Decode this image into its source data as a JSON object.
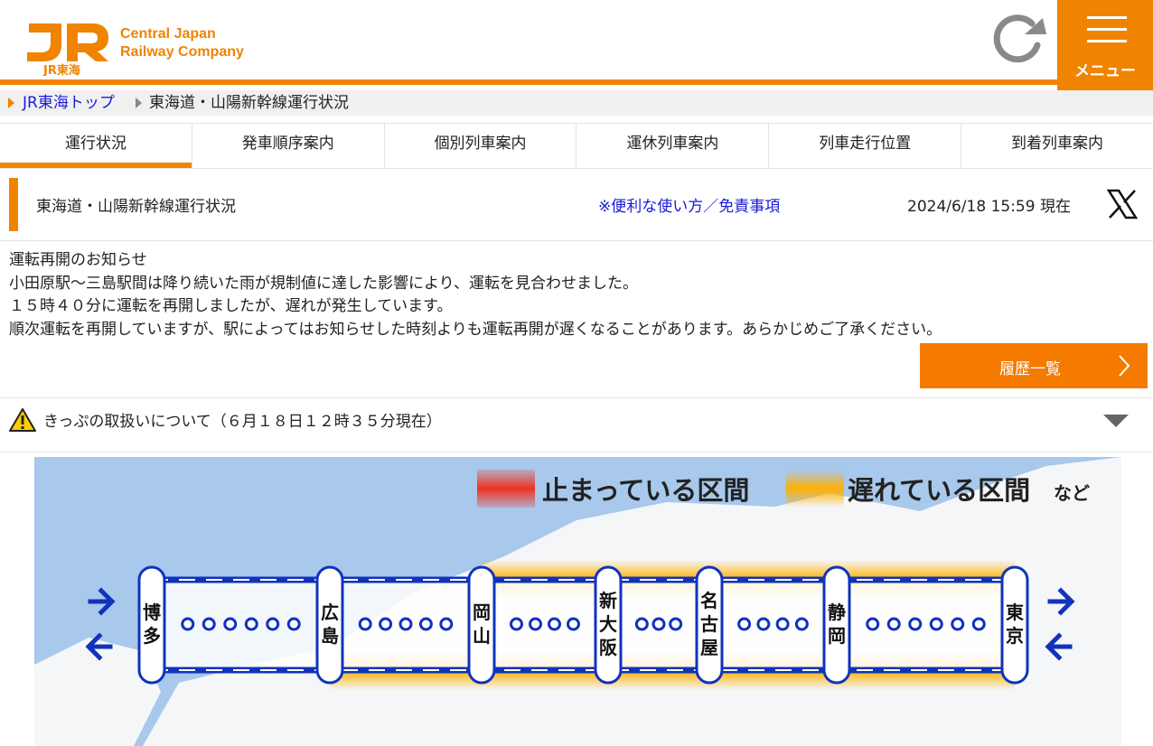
{
  "header": {
    "logo_text": "JR",
    "logo_sub": "JR東海",
    "corp_line1": "Central Japan",
    "corp_line2": "Railway Company",
    "menu_label": "メニュー"
  },
  "breadcrumb": {
    "top_link": "JR東海トップ",
    "current": "東海道・山陽新幹線運行状況"
  },
  "tabs": [
    {
      "label": "運行状況"
    },
    {
      "label": "発車順序案内"
    },
    {
      "label": "個別列車案内"
    },
    {
      "label": "運休列車案内"
    },
    {
      "label": "列車走行位置"
    },
    {
      "label": "到着列車案内"
    }
  ],
  "status": {
    "title": "東海道・山陽新幹線運行状況",
    "help_link": "※便利な使い方／免責事項",
    "updated": "2024/6/18 15:59 現在"
  },
  "notice": {
    "lines": [
      "運転再開のお知らせ",
      "小田原駅～三島駅間は降り続いた雨が規制値に達した影響により、運転を見合わせました。",
      "１５時４０分に運転を再開しましたが、遅れが発生しています。",
      "順次運転を再開していますが、駅によってはお知らせした時刻よりも運転再開が遅くなることがあります。あらかじめご了承ください。"
    ],
    "history_button": "履歴一覧"
  },
  "ticket": {
    "text": "きっぷの取扱いについて（６月１８日１２時３５分現在）"
  },
  "map": {
    "legend_stopped": "止まっている区間",
    "legend_delayed": "遅れている区間",
    "legend_suffix": "など",
    "stations": [
      "博多",
      "広島",
      "岡山",
      "新大阪",
      "名古屋",
      "静岡",
      "東京"
    ],
    "dots_between": [
      6,
      5,
      4,
      3,
      4,
      6
    ],
    "delay_sections": [
      {
        "from": "岡山",
        "to": "東京",
        "direction": "up",
        "status": "delayed"
      },
      {
        "from": "東京",
        "to": "広島",
        "direction": "down",
        "status": "delayed"
      }
    ],
    "colors": {
      "line": "#1133bb",
      "stopped": "#ee3322",
      "delayed": "#ffb000",
      "sea": "#a8c8ec",
      "land": "#f4f6f8"
    }
  }
}
